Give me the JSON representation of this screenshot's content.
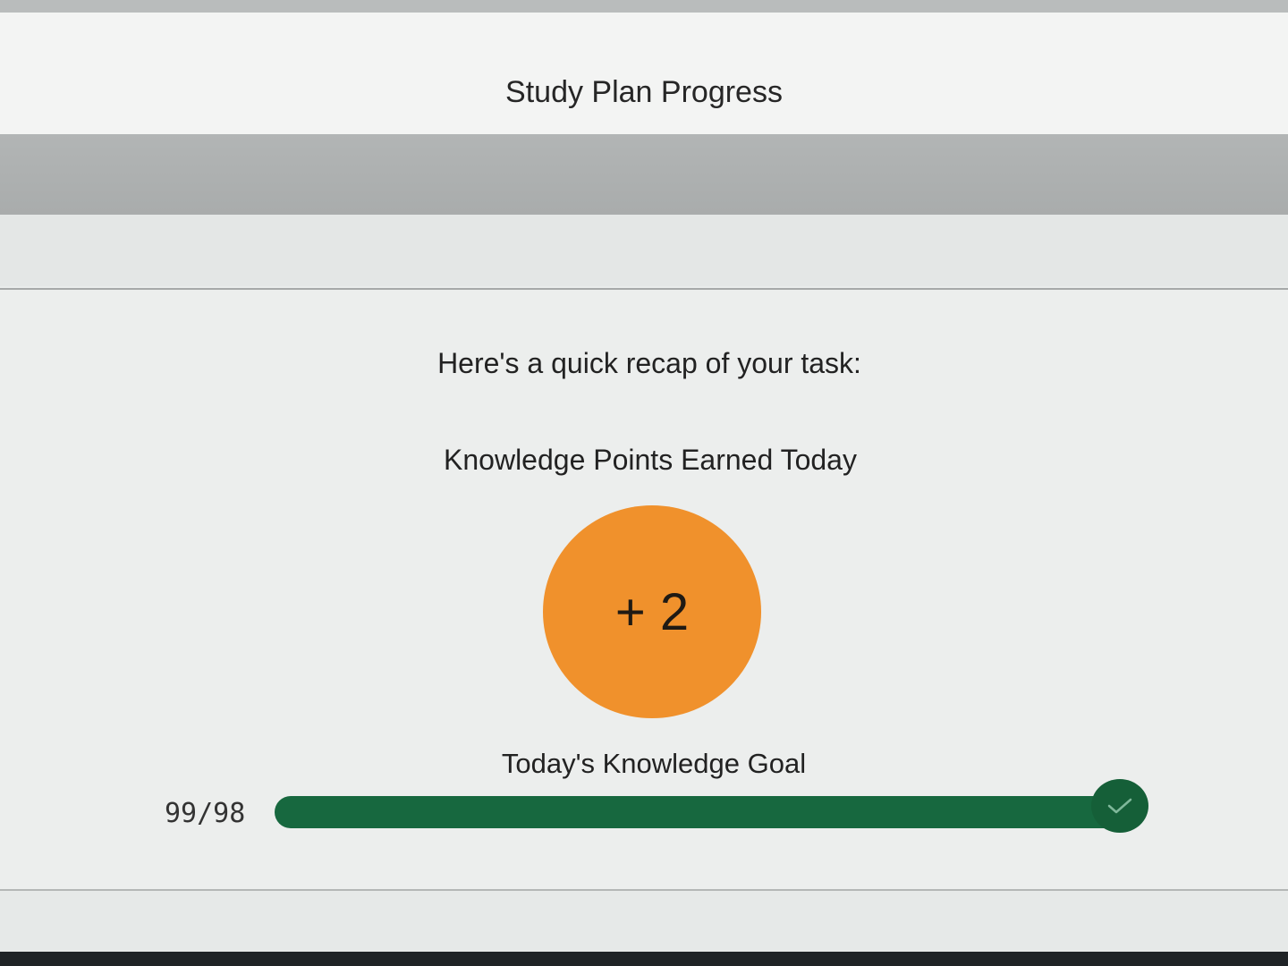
{
  "header": {
    "title": "Study Plan Progress"
  },
  "recap": {
    "intro": "Here's a quick recap of your task:"
  },
  "knowledge_points": {
    "title": "Knowledge Points Earned Today",
    "value": "+ 2",
    "circle_color": "#f0912c"
  },
  "goal": {
    "title": "Today's Knowledge Goal",
    "count": "99/98",
    "progress_fraction": 1.0,
    "bar_color": "#17683f",
    "complete_icon": "check-icon"
  }
}
